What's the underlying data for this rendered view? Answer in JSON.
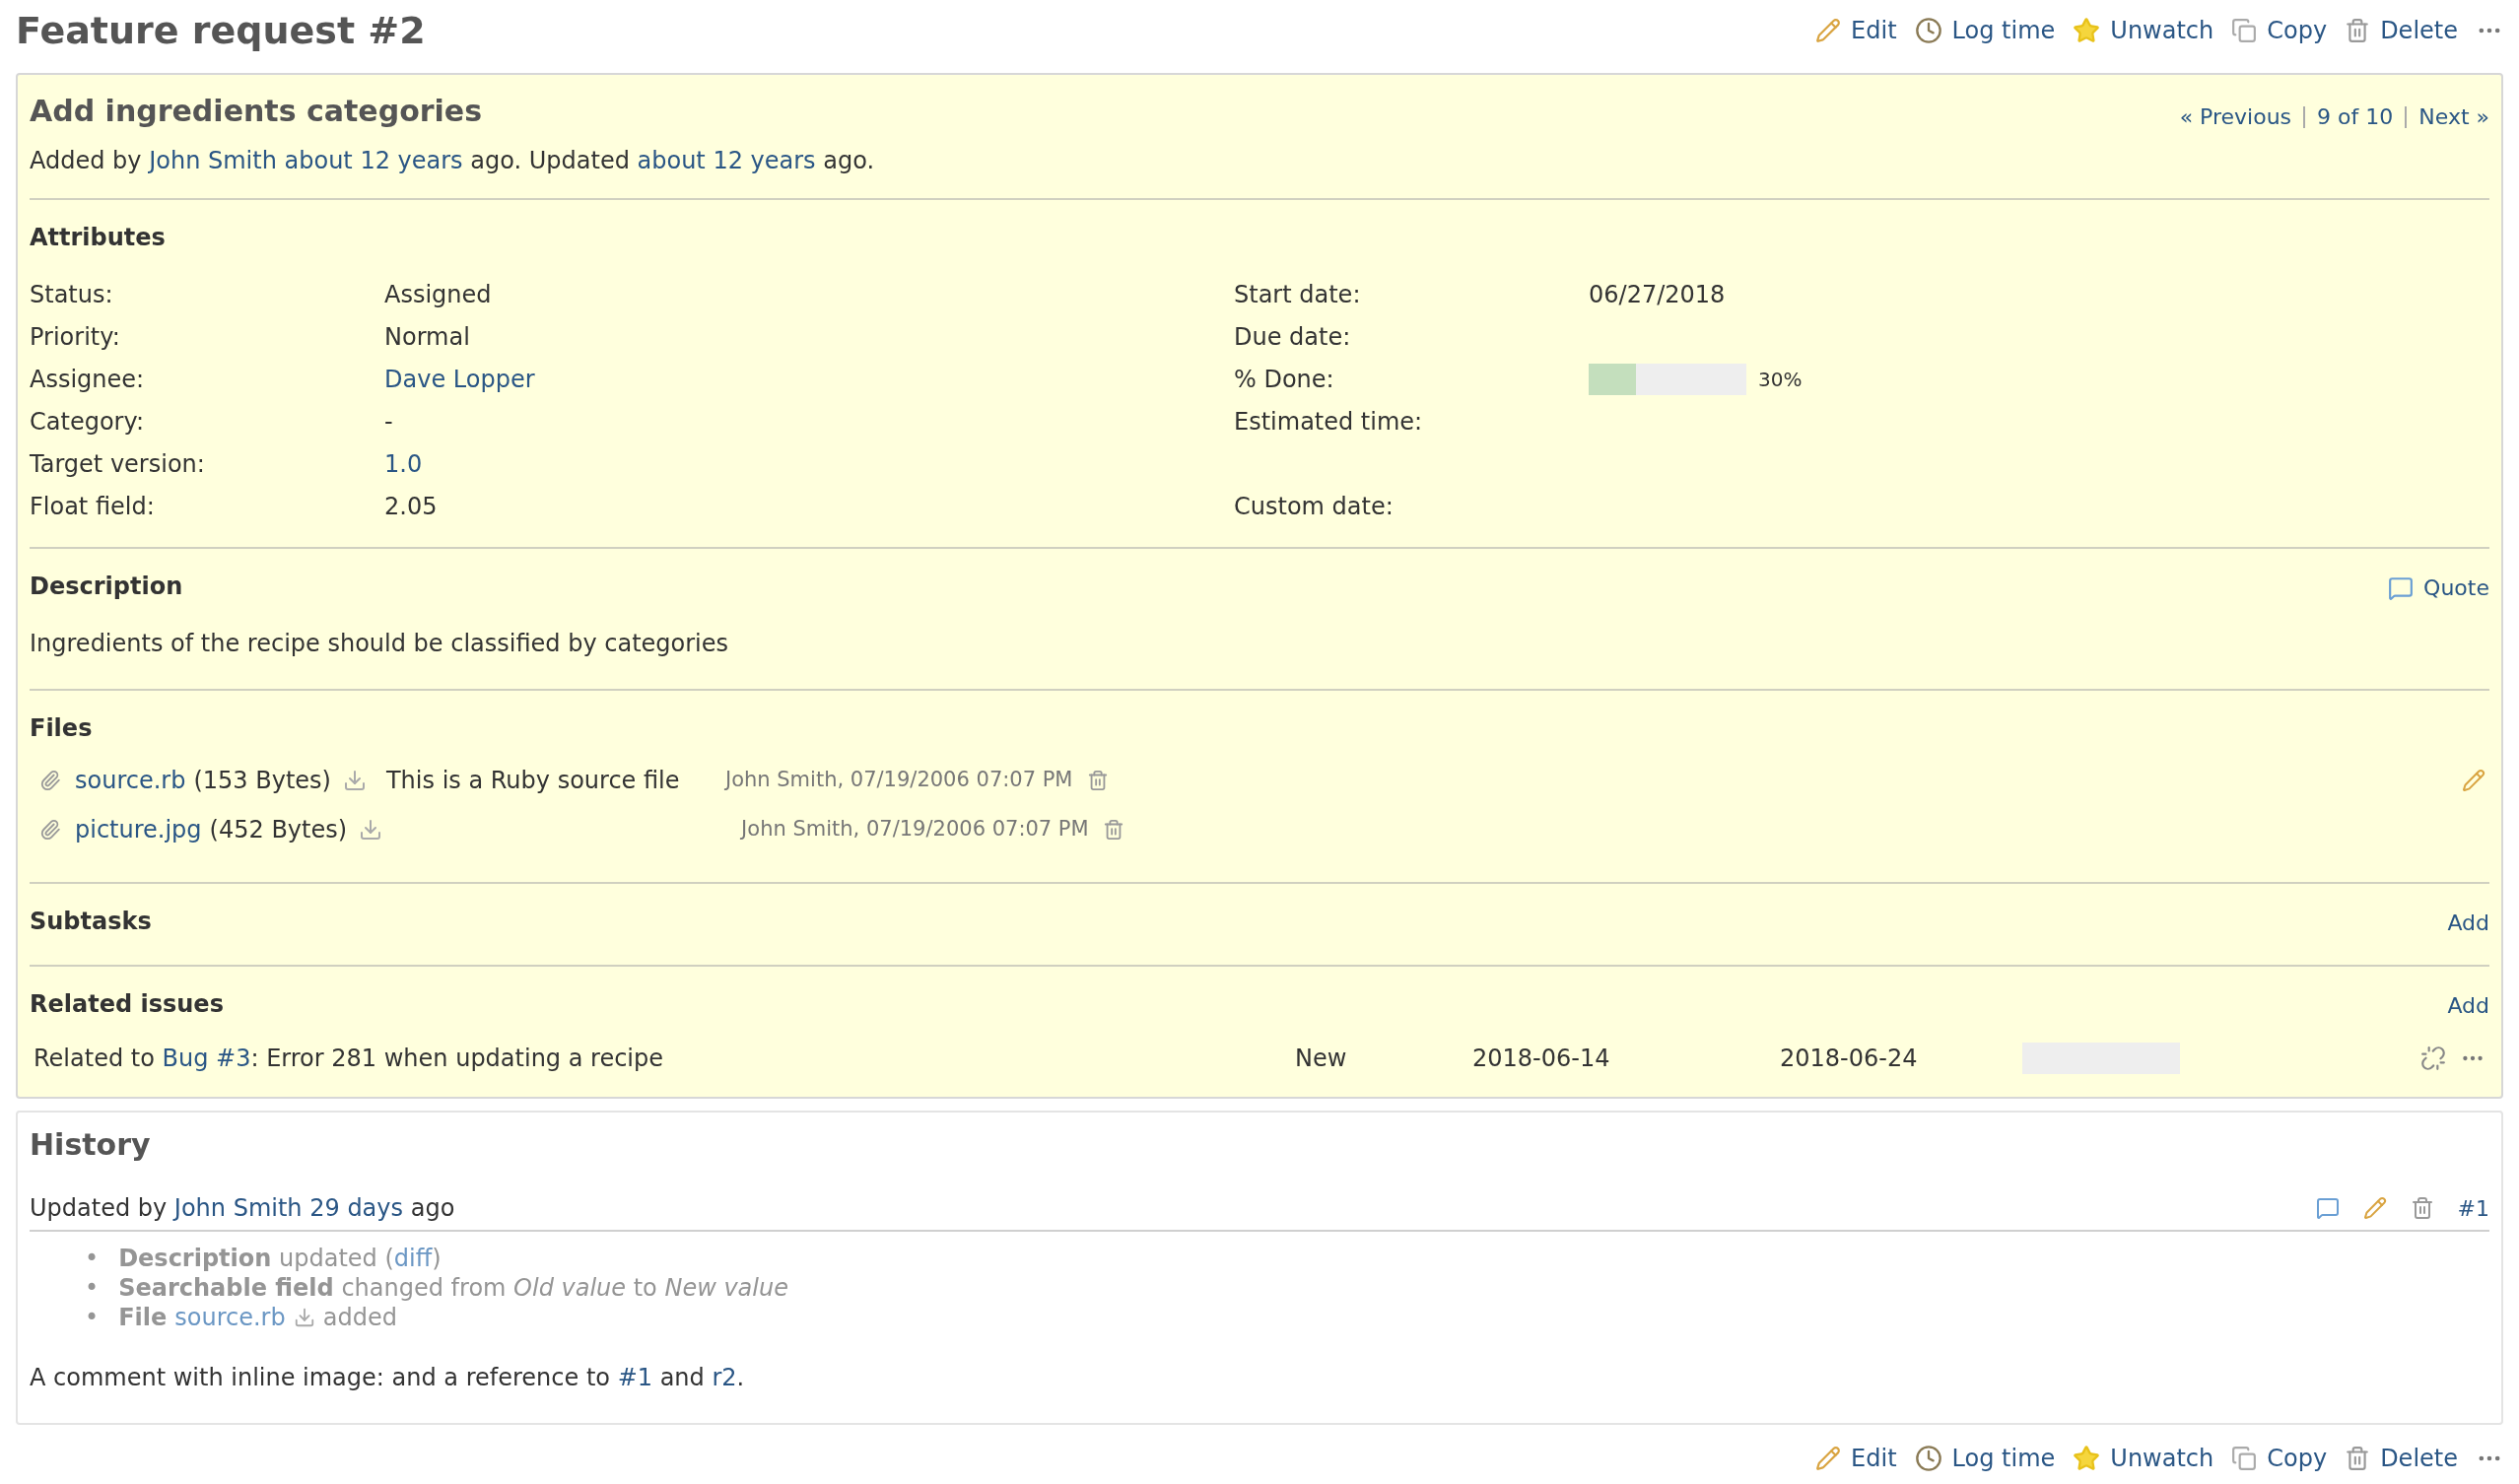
{
  "title": "Feature request #2",
  "actions": [
    {
      "kind": "edit",
      "label": "Edit"
    },
    {
      "kind": "log",
      "label": "Log time"
    },
    {
      "kind": "watch",
      "label": "Unwatch"
    },
    {
      "kind": "copy",
      "label": "Copy"
    },
    {
      "kind": "delete",
      "label": "Delete"
    }
  ],
  "bottom_actions": [
    {
      "kind": "edit",
      "label": "Edit"
    },
    {
      "kind": "log",
      "label": "Log time"
    },
    {
      "kind": "watch",
      "label": "Unwatch"
    },
    {
      "kind": "copy",
      "label": "Copy"
    },
    {
      "kind": "delete",
      "label": "Delete"
    }
  ],
  "issue": {
    "subject": "Add ingredients categories",
    "nav": {
      "previous": "« Previous",
      "position": "9 of 10",
      "next": "Next »"
    },
    "byline": [
      {
        "kind": "text",
        "text": "Added by"
      },
      {
        "kind": "link",
        "text": "John Smith"
      },
      {
        "kind": "link",
        "text": "about 12 years"
      },
      {
        "kind": "text",
        "text": "ago. Updated"
      },
      {
        "kind": "link",
        "text": "about 12 years"
      },
      {
        "kind": "text",
        "text": "ago."
      }
    ],
    "attributes_heading": "Attributes",
    "attributes_left": [
      {
        "label": "Status:",
        "value": "Assigned",
        "kind": "text"
      },
      {
        "label": "Priority:",
        "value": "Normal",
        "kind": "text"
      },
      {
        "label": "Assignee:",
        "value": "Dave Lopper",
        "kind": "link"
      },
      {
        "label": "Category:",
        "value": "-",
        "kind": "text"
      },
      {
        "label": "Target version:",
        "value": "1.0",
        "kind": "link"
      },
      {
        "label": "Float field:",
        "value": "2.05",
        "kind": "text"
      }
    ],
    "attributes_right": [
      {
        "label": "Start date:",
        "value": "06/27/2018",
        "kind": "text"
      },
      {
        "label": "Due date:",
        "kind": "text"
      },
      {
        "label": "% Done:",
        "kind": "progress",
        "level": 0.3,
        "value": "30%"
      },
      {
        "label": "Estimated time:",
        "kind": "text"
      },
      {
        "kind": "blank"
      },
      {
        "label": "Custom date:",
        "kind": "text"
      }
    ],
    "description_heading": "Description",
    "quote": "Quote",
    "description": "Ingredients of the recipe should be classified by categories",
    "files_heading": "Files",
    "files": [
      {
        "name": "source.rb",
        "size": "(153 Bytes)",
        "description": "This is a Ruby source file",
        "author": "John Smith, 07/19/2006 07:07 PM"
      },
      {
        "name": "picture.jpg",
        "size": "(452 Bytes)",
        "author": "John Smith, 07/19/2006 07:07 PM"
      }
    ],
    "subtasks_heading": "Subtasks",
    "subtasks_add": "Add",
    "related_heading": "Related issues",
    "related_add": "Add",
    "related": [
      {
        "relation": "Related to",
        "link": "Bug #3",
        "subject": ": Error 281 when updating a recipe",
        "status": "New",
        "start": "2018-06-14",
        "due": "2018-06-24",
        "level": 0
      }
    ]
  },
  "history": {
    "heading": "History",
    "journals": [
      {
        "prefix": "Updated by",
        "author": "John Smith",
        "age": "29 days",
        "suffix": "ago",
        "number": "#1",
        "details": [
          {
            "bullet": "•",
            "kind": "diff",
            "field": "Description",
            "text": "updated (",
            "link": "diff",
            "after": ")"
          },
          {
            "bullet": "•",
            "kind": "change",
            "text": "**Searchable field** changed from *Old value* to *New value*"
          },
          {
            "bullet": "•",
            "kind": "file",
            "field": "File",
            "link": "source.rb",
            "text": "added"
          }
        ],
        "comment": [
          {
            "kind": "text",
            "text": "A comment with inline image:  and a reference to"
          },
          {
            "kind": "link",
            "text": "#1"
          },
          {
            "kind": "text",
            "text": "and"
          },
          {
            "kind": "link",
            "text": "r2"
          },
          {
            "kind": "text",
            "text": "."
          }
        ]
      }
    ]
  }
}
